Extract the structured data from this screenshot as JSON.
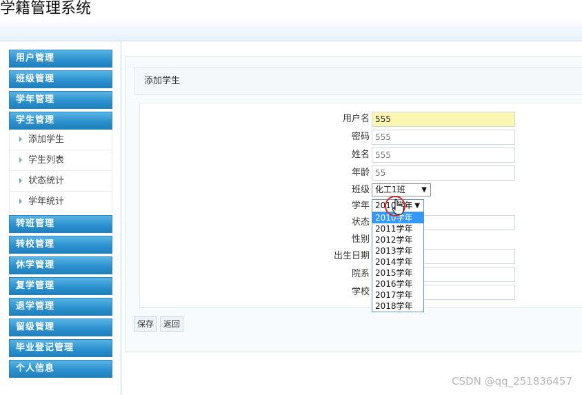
{
  "app": {
    "title": "学籍管理系统"
  },
  "sidebar": {
    "menu": [
      {
        "label": "用户管理"
      },
      {
        "label": "班级管理"
      },
      {
        "label": "学年管理"
      },
      {
        "label": "学生管理"
      },
      {
        "label": "转班管理"
      },
      {
        "label": "转校管理"
      },
      {
        "label": "休学管理"
      },
      {
        "label": "复学管理"
      },
      {
        "label": "退学管理"
      },
      {
        "label": "留级管理"
      },
      {
        "label": "毕业登记管理"
      },
      {
        "label": "个人信息"
      }
    ],
    "student_submenu": [
      {
        "label": "添加学生"
      },
      {
        "label": "学生列表"
      },
      {
        "label": "状态统计"
      },
      {
        "label": "学年统计"
      }
    ]
  },
  "page": {
    "header": "添加学生"
  },
  "form": {
    "labels": {
      "username": "用户名",
      "password": "密码",
      "name": "姓名",
      "age": "年龄",
      "class": "班级",
      "year": "学年",
      "status": "状态",
      "gender": "性别",
      "birthdate": "出生日期",
      "department": "院系",
      "school": "学校"
    },
    "values": {
      "username": "555",
      "password": "555",
      "name": "555",
      "age": "55",
      "class": "化工1班",
      "year": "2010学年"
    },
    "year_options": [
      "2010学年",
      "2011学年",
      "2012学年",
      "2013学年",
      "2014学年",
      "2015学年",
      "2016学年",
      "2017学年",
      "2018学年"
    ]
  },
  "buttons": {
    "save": "保存",
    "back": "返回"
  },
  "watermark": "CSDN @qq_251836457",
  "colors": {
    "menu_blue": "#2d92cf",
    "selected_option": "#3399ff",
    "active_input": "#fbf7b0"
  }
}
